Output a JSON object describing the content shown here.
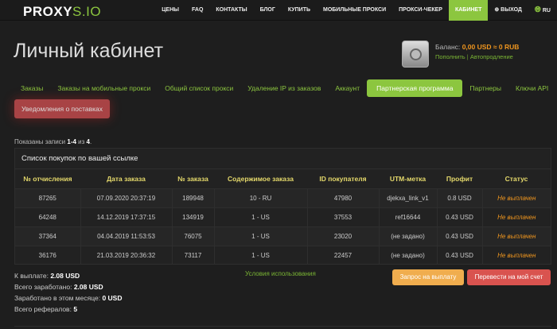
{
  "header": {
    "logo": "PROXYS.IO",
    "nav": [
      "ЦЕНЫ",
      "FAQ",
      "КОНТАКТЫ",
      "БЛОГ",
      "КУПИТЬ",
      "МОБИЛЬНЫЕ ПРОКСИ",
      "ПРОКСИ-ЧЕКЕР",
      "КАБИНЕТ",
      "⊕ ВЫХОД"
    ],
    "lang": "RU"
  },
  "page": {
    "title": "Личный кабинет"
  },
  "balance": {
    "label": "Баланс:",
    "value": "0,00 USD ≈ 0 RUB",
    "topup": "Пополнить",
    "sep": "|",
    "autorenew": "Автопродление"
  },
  "tabs": [
    "Заказы",
    "Заказы на мобильные прокси",
    "Общий список прокси",
    "Удаление IP из заказов",
    "Аккаунт",
    "Партнерская программа",
    "Партнеры",
    "Ключи API"
  ],
  "notifications_button": "Уведомления о поставках",
  "shown": {
    "prefix": "Показаны записи",
    "range": "1-4",
    "of": "из",
    "total": "4",
    "suffix": "."
  },
  "table": {
    "title": "Список покупок по вашей ссылке",
    "columns": [
      "№ отчисления",
      "Дата заказа",
      "№ заказа",
      "Содержимое заказа",
      "ID покупателя",
      "UTM-метка",
      "Профит",
      "Статус"
    ],
    "rows": [
      [
        "87265",
        "07.09.2020 20:37:19",
        "189948",
        "10 - RU",
        "47980",
        "djekxa_link_v1",
        "0.8 USD",
        "Не выплачен"
      ],
      [
        "64248",
        "14.12.2019 17:37:15",
        "134919",
        "1 - US",
        "37553",
        "ref16644",
        "0.43 USD",
        "Не выплачен"
      ],
      [
        "37364",
        "04.04.2019 11:53:53",
        "76075",
        "1 - US",
        "23020",
        "(не задано)",
        "0.43 USD",
        "Не выплачен"
      ],
      [
        "36176",
        "21.03.2019 20:36:32",
        "73117",
        "1 - US",
        "22457",
        "(не задано)",
        "0.43 USD",
        "Не выплачен"
      ]
    ]
  },
  "summary": [
    {
      "label": "К выплате:",
      "value": "2.08 USD"
    },
    {
      "label": "Всего заработано:",
      "value": "2.08 USD"
    },
    {
      "label": "Заработано в этом месяце:",
      "value": "0 USD"
    },
    {
      "label": "Всего рефералов:",
      "value": "5"
    }
  ],
  "terms_link": "Условия использования",
  "buttons": {
    "request_payout": "Запрос на выплату",
    "transfer": "Перевести на мой счет"
  },
  "colors": {
    "accent": "#8cc63f",
    "status": "#f0961e",
    "warning": "#f0ad4e",
    "danger": "#d9534f"
  }
}
